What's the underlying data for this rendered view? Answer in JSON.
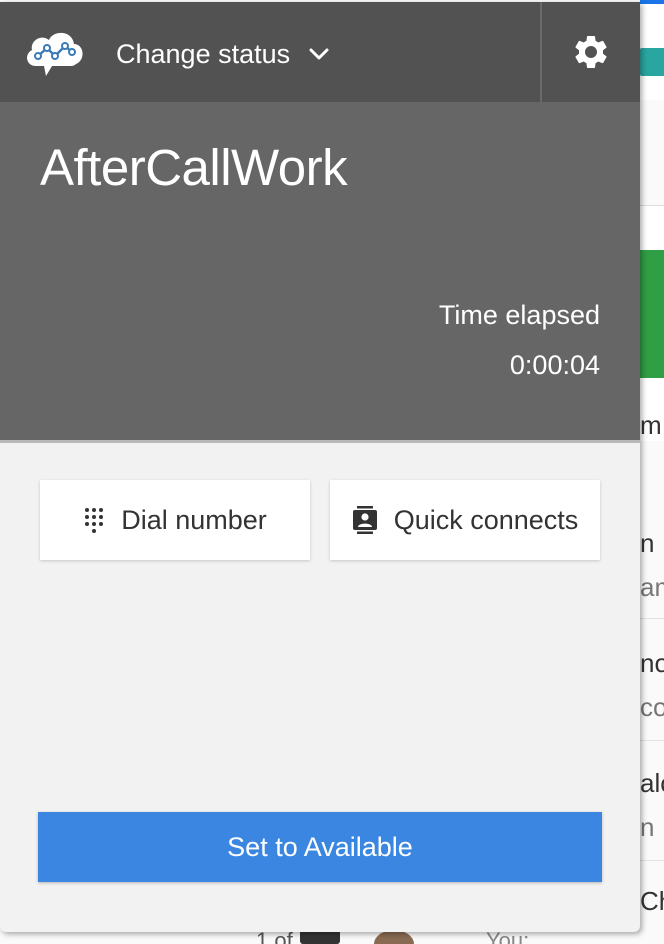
{
  "header": {
    "logo_icon": "cloud-network-icon",
    "status_dropdown_label": "Change status",
    "dropdown_icon": "chevron-down-icon",
    "settings_icon": "gear-icon"
  },
  "state": {
    "name": "AfterCallWork",
    "elapsed_label": "Time elapsed",
    "elapsed_value": "0:00:04"
  },
  "actions": {
    "dial_number": {
      "label": "Dial number",
      "icon": "dialpad-icon"
    },
    "quick_connects": {
      "label": "Quick connects",
      "icon": "contact-book-icon"
    }
  },
  "primary_action": {
    "label": "Set to Available"
  },
  "background_app": {
    "peek_texts": [
      "m",
      "n",
      "am",
      "no",
      "co",
      "alo",
      "n",
      "Ch"
    ],
    "bottom_row": {
      "page_text": "1 of",
      "message_text": "You:"
    }
  },
  "colors": {
    "header_bg": "#525252",
    "state_bg": "#666666",
    "panel_bg": "#f2f2f2",
    "primary_button": "#3a86e0",
    "text_on_dark": "#ffffff"
  }
}
